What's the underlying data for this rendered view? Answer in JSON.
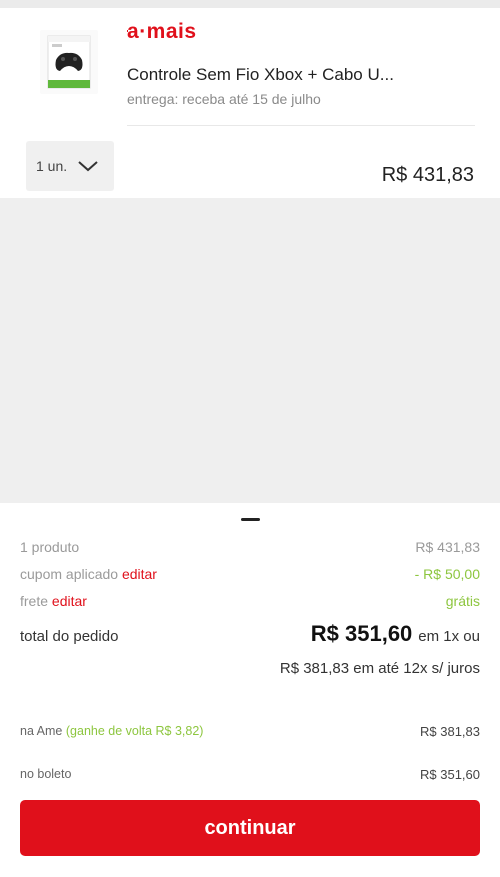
{
  "product": {
    "brand_prefix": "a",
    "brand_suffix": "·mais",
    "title": "Controle Sem Fio Xbox + Cabo U...",
    "delivery": "entrega: receba até 15 de julho",
    "quantity": "1 un.",
    "price": "R$ 431,83",
    "thumbnail_icon": "xbox-controller-box-icon"
  },
  "summary": {
    "products_label": "1 produto",
    "products_value": "R$ 431,83",
    "coupon_label": "cupom aplicado",
    "coupon_edit": "editar",
    "coupon_value": "- R$ 50,00",
    "shipping_label": "frete",
    "shipping_edit": "editar",
    "shipping_value": "grátis",
    "total_label": "total do pedido",
    "total_value": "R$ 351,60",
    "total_suffix": "em 1x ou",
    "installments": "R$ 381,83 em até 12x s/ juros"
  },
  "payment": {
    "ame_label": "na Ame",
    "ame_cashback": "(ganhe de volta R$ 3,82)",
    "ame_value": "R$ 381,83",
    "boleto_label": "no boleto",
    "boleto_value": "R$ 351,60"
  },
  "cta": {
    "label": "continuar"
  },
  "colors": {
    "brand_red": "#e0101b",
    "green": "#8dc63f"
  }
}
